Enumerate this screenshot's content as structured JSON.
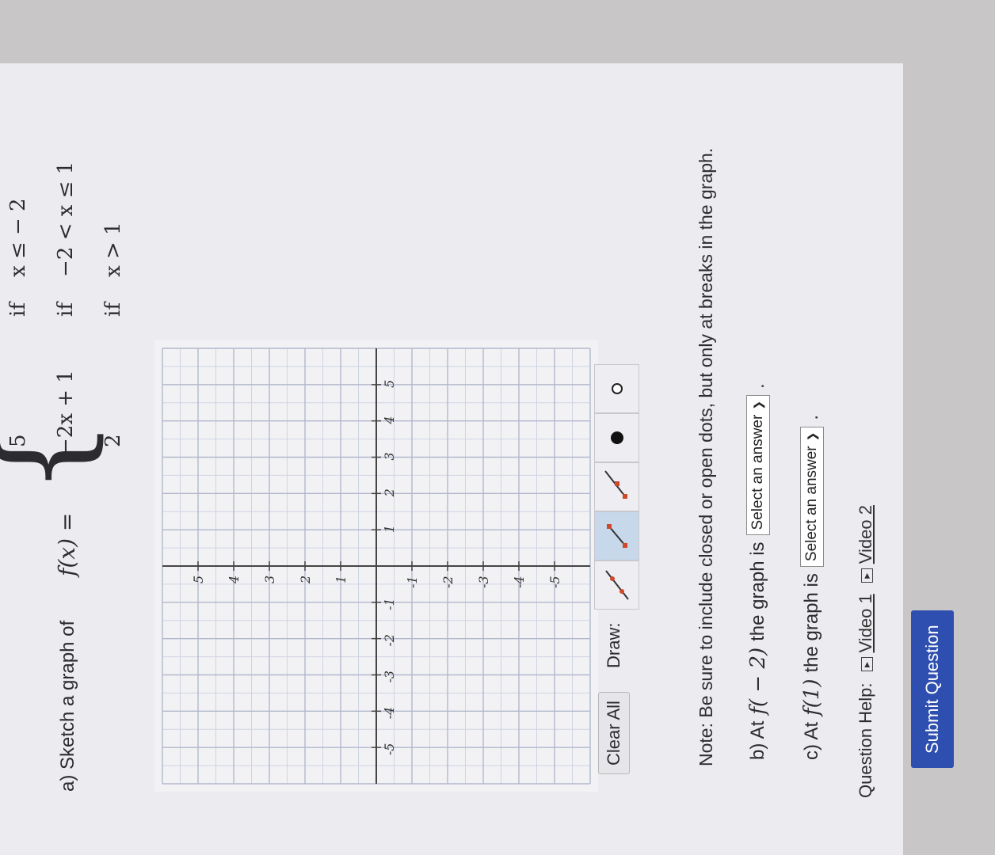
{
  "question": {
    "part_a_prefix": "a) Sketch a graph of",
    "fx": "f(x) =",
    "pieces": [
      {
        "expr": "5",
        "cond_if": "if",
        "cond": "x ≤ − 2"
      },
      {
        "expr": "−2x + 1",
        "cond_if": "if",
        "cond": "−2 < x ≤ 1"
      },
      {
        "expr": "2",
        "cond_if": "if",
        "cond": "x > 1"
      }
    ]
  },
  "graph": {
    "x_ticks": [
      "-5",
      "-4",
      "-3",
      "-2",
      "-1",
      "1",
      "2",
      "3",
      "4",
      "5"
    ],
    "y_ticks": [
      "5",
      "4",
      "3",
      "2",
      "1",
      "-1",
      "-2",
      "-3",
      "-4",
      "-5"
    ]
  },
  "toolbar": {
    "clear_all": "Clear All",
    "draw_label": "Draw:",
    "tools": [
      "line-icon",
      "segment-icon",
      "ray-icon",
      "closed-dot-icon",
      "open-dot-icon"
    ]
  },
  "note": "Note: Be sure to include closed or open dots, but only at breaks in the graph.",
  "part_b": {
    "prefix": "b) At",
    "fn": "f( − 2)",
    "suffix": "the graph is",
    "select": "Select an answer",
    "end": "."
  },
  "part_c": {
    "prefix": "c) At",
    "fn": "f(1)",
    "suffix": "the graph is",
    "select": "Select an answer",
    "end": "."
  },
  "help": {
    "label": "Question Help:",
    "video1": "Video 1",
    "video2": "Video 2"
  },
  "submit": "Submit Question",
  "colors": {
    "accent": "#2f4fb0",
    "tool_red": "#d0482a",
    "tool_active": "#c6d8ea"
  }
}
